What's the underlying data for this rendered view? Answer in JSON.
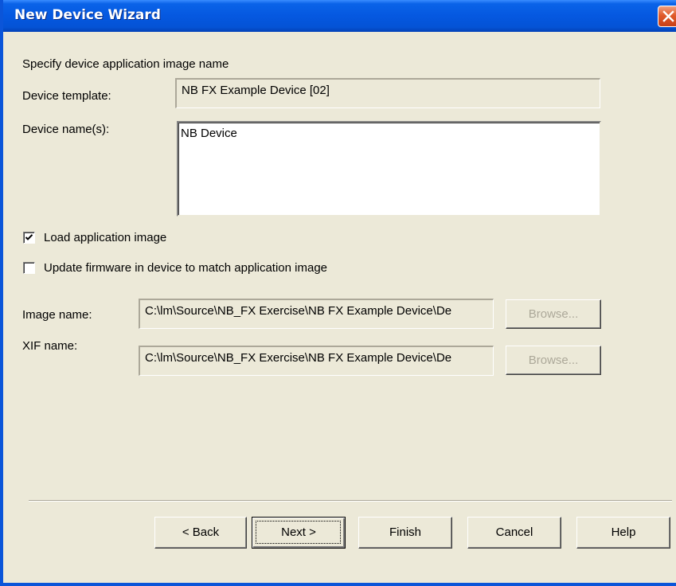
{
  "window": {
    "title": "New Device Wizard"
  },
  "heading": "Specify device application image name",
  "device_template": {
    "label": "Device template:",
    "value": "NB FX Example Device [02]"
  },
  "device_names": {
    "label": "Device name(s):",
    "value": "NB Device"
  },
  "options": {
    "load_image": {
      "label": "Load application image",
      "checked": true
    },
    "update_firmware": {
      "label": "Update firmware in device to match application image",
      "checked": false
    }
  },
  "image_name": {
    "label": "Image name:",
    "value": "C:\\lm\\Source\\NB_FX Exercise\\NB FX Example Device\\De",
    "browse_label": "Browse..."
  },
  "xif_name": {
    "label": "XIF name:",
    "value": "C:\\lm\\Source\\NB_FX Exercise\\NB FX Example Device\\De",
    "browse_label": "Browse..."
  },
  "buttons": {
    "back": "< Back",
    "next": "Next >",
    "finish": "Finish",
    "cancel": "Cancel",
    "help": "Help"
  },
  "colors": {
    "titlebar": "#0558e0",
    "dialog_bg": "#ece9d8",
    "close_button": "#e05a2a",
    "disabled_text": "#aca899"
  },
  "icons": {
    "close": "close-icon",
    "checkmark": "checkmark-icon"
  }
}
